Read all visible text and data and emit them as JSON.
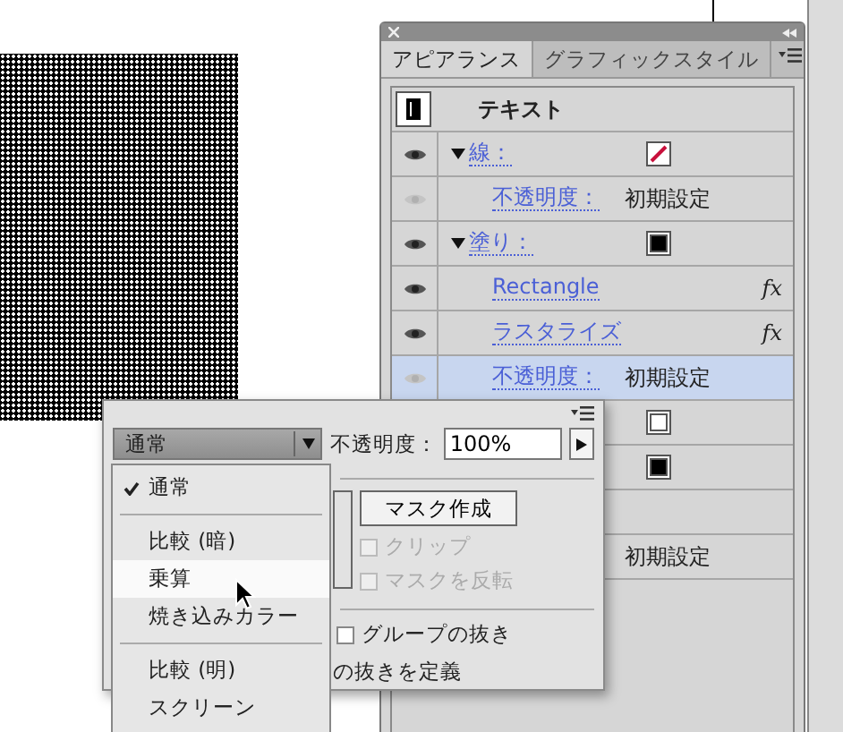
{
  "panel": {
    "tabs": [
      {
        "label": "アピアランス",
        "selected": true
      },
      {
        "label": "グラフィックスタイル",
        "selected": false
      }
    ],
    "rows": [
      {
        "kind": "header",
        "label": "テキスト"
      },
      {
        "kind": "stroke",
        "visible": true,
        "expanded": true,
        "label": "線：",
        "color": "#c8103c",
        "selected": false
      },
      {
        "kind": "sub",
        "visible": false,
        "label": "不透明度：",
        "value": "初期設定",
        "selected": false
      },
      {
        "kind": "fill",
        "visible": true,
        "expanded": true,
        "label": "塗り：",
        "color": "#000000",
        "selected": false
      },
      {
        "kind": "effect",
        "visible": true,
        "label": "Rectangle",
        "fx": "fx",
        "selected": false
      },
      {
        "kind": "effect",
        "visible": true,
        "label": "ラスタライズ",
        "fx": "fx",
        "selected": false
      },
      {
        "kind": "sub",
        "visible": false,
        "label": "不透明度：",
        "value": "初期設定",
        "selected": true
      },
      {
        "kind": "covered",
        "color": "#ffffff"
      },
      {
        "kind": "covered",
        "color": "#000000"
      },
      {
        "kind": "covered"
      },
      {
        "kind": "value",
        "value": "初期設定"
      },
      {
        "kind": "blank"
      }
    ]
  },
  "transparency": {
    "blend_mode": "通常",
    "opacity_label": "不透明度：",
    "opacity": "100%",
    "make_mask": "マスク作成",
    "checks": [
      {
        "label": "クリップ",
        "checked": false,
        "disabled": true
      },
      {
        "label": "マスクを反転",
        "checked": false,
        "disabled": true
      }
    ],
    "knockout": {
      "label": "グループの抜き",
      "checked": false
    },
    "define_knockout": "の抜きを定義"
  },
  "blend_menu": [
    {
      "kind": "item",
      "label": "通常",
      "checked": true,
      "selected": false
    },
    {
      "kind": "separator"
    },
    {
      "kind": "item",
      "label": "比較 (暗)",
      "checked": false,
      "selected": false
    },
    {
      "kind": "item",
      "label": "乗算",
      "checked": false,
      "selected": true
    },
    {
      "kind": "item",
      "label": "焼き込みカラー",
      "checked": false,
      "selected": false
    },
    {
      "kind": "separator"
    },
    {
      "kind": "item",
      "label": "比較 (明)",
      "checked": false,
      "selected": false
    },
    {
      "kind": "item",
      "label": "スクリーン",
      "checked": false,
      "selected": false
    }
  ]
}
